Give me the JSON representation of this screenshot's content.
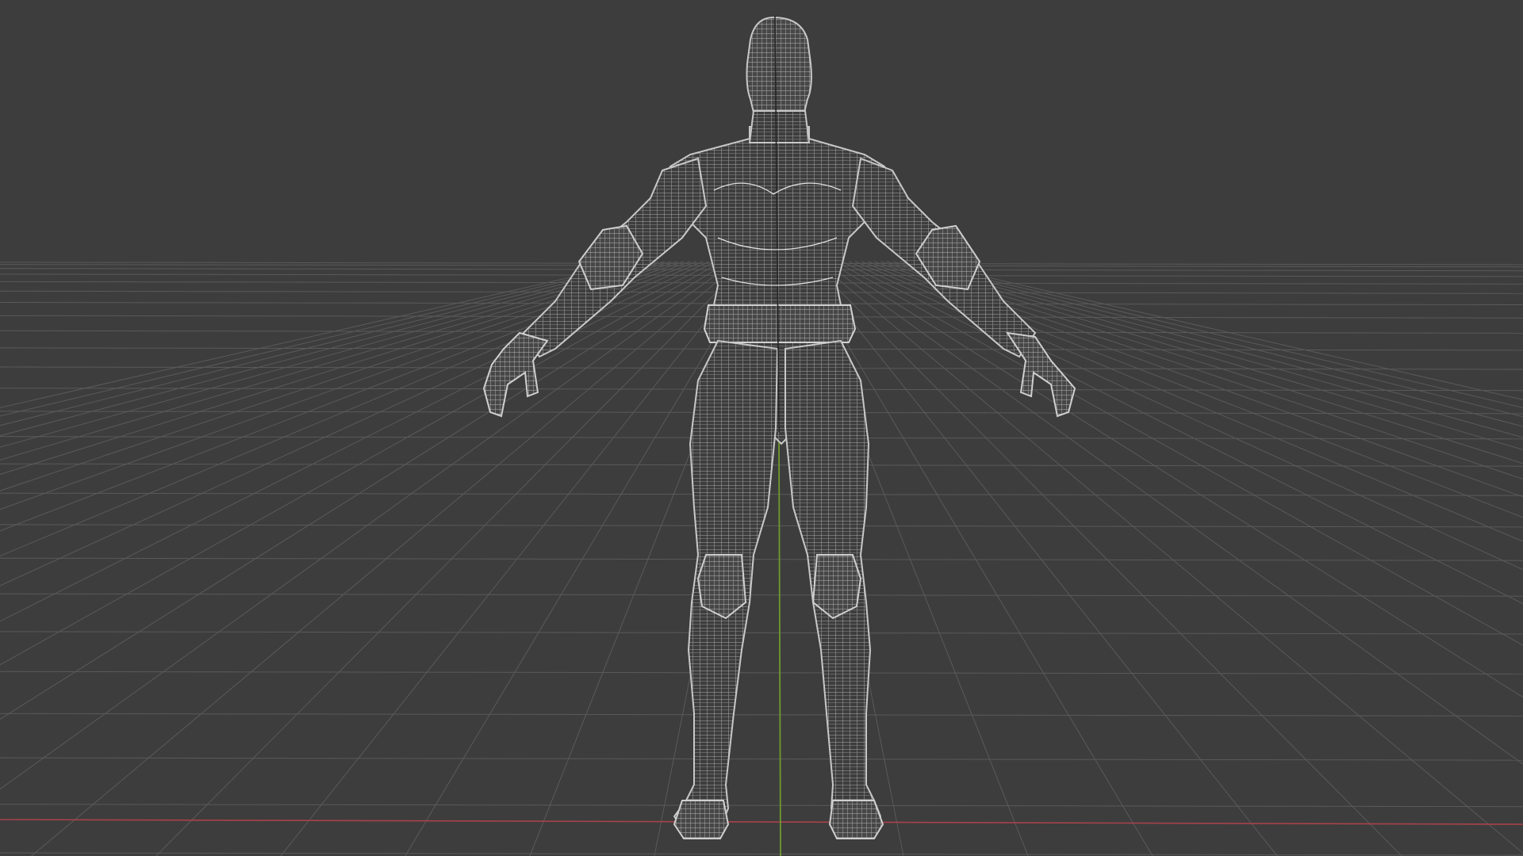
{
  "viewport": {
    "mode": "wireframe",
    "view": "front-orthographic-perspective",
    "background_color": "#3d3d3d",
    "grid_color": "#5a5a5a",
    "wire_color": "#bdbdbd",
    "x_axis_color": "#a8424b",
    "y_axis_color": "#6f9a2e",
    "object": "humanoid-character-mesh",
    "pose": "a-pose"
  }
}
